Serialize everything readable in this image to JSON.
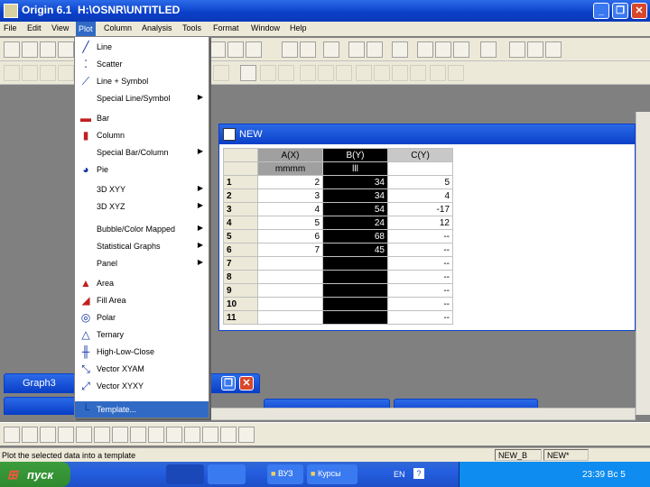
{
  "window": {
    "title": "Origin 6.1  H:\\OSNR\\UNTITLED"
  },
  "window_buttons": {
    "min": "_",
    "max": "❐",
    "close": "✕"
  },
  "menubar": {
    "items": [
      "File",
      "Edit",
      "View",
      "Plot",
      "Column",
      "Analysis",
      "Tools",
      "Format",
      "Window",
      "Help"
    ]
  },
  "plot_menu": {
    "items": [
      {
        "label": "Line",
        "icon": "line-icon",
        "glyph": "╱",
        "submenu": false
      },
      {
        "label": "Scatter",
        "icon": "scatter-icon",
        "glyph": "⁚",
        "submenu": false
      },
      {
        "label": "Line + Symbol",
        "icon": "line-symbol-icon",
        "glyph": "⟋",
        "submenu": false
      },
      {
        "label": "Special Line/Symbol",
        "icon": "",
        "glyph": "",
        "submenu": true
      },
      {
        "label": "Bar",
        "icon": "bar-icon",
        "glyph": "▬",
        "submenu": false
      },
      {
        "label": "Column",
        "icon": "column-icon",
        "glyph": "▮",
        "submenu": false
      },
      {
        "label": "Special Bar/Column",
        "icon": "",
        "glyph": "",
        "submenu": true
      },
      {
        "label": "Pie",
        "icon": "pie-icon",
        "glyph": "◕",
        "submenu": false
      },
      {
        "label": "3D XYY",
        "icon": "",
        "glyph": "",
        "submenu": true
      },
      {
        "label": "3D XYZ",
        "icon": "",
        "glyph": "",
        "submenu": true
      },
      {
        "label": "Bubble/Color Mapped",
        "icon": "",
        "glyph": "",
        "submenu": true
      },
      {
        "label": "Statistical Graphs",
        "icon": "",
        "glyph": "",
        "submenu": true
      },
      {
        "label": "Panel",
        "icon": "",
        "glyph": "",
        "submenu": true
      },
      {
        "label": "Area",
        "icon": "area-icon",
        "glyph": "▲",
        "submenu": false
      },
      {
        "label": "Fill Area",
        "icon": "fill-area-icon",
        "glyph": "◢",
        "submenu": false
      },
      {
        "label": "Polar",
        "icon": "polar-icon",
        "glyph": "◎",
        "submenu": false
      },
      {
        "label": "Ternary",
        "icon": "ternary-icon",
        "glyph": "△",
        "submenu": false
      },
      {
        "label": "High-Low-Close",
        "icon": "high-low-close-icon",
        "glyph": "╫",
        "submenu": false
      },
      {
        "label": "Vector XYAM",
        "icon": "vector-xyam-icon",
        "glyph": "⤡",
        "submenu": false
      },
      {
        "label": "Vector XYXY",
        "icon": "vector-xyxy-icon",
        "glyph": "⤢",
        "submenu": false
      },
      {
        "label": "Template...",
        "icon": "template-icon",
        "glyph": "└",
        "submenu": false
      }
    ]
  },
  "worksheet": {
    "title": "NEW",
    "columns": [
      {
        "name": "A(X)",
        "label": "mmmm"
      },
      {
        "name": "B(Y)",
        "label": "lll"
      },
      {
        "name": "C(Y)",
        "label": ""
      }
    ],
    "rows": [
      {
        "n": "1",
        "a": "2",
        "b": "34",
        "c": "5"
      },
      {
        "n": "2",
        "a": "3",
        "b": "34",
        "c": "4"
      },
      {
        "n": "3",
        "a": "4",
        "b": "54",
        "c": "-17"
      },
      {
        "n": "4",
        "a": "5",
        "b": "24",
        "c": "12"
      },
      {
        "n": "5",
        "a": "6",
        "b": "68",
        "c": "--"
      },
      {
        "n": "6",
        "a": "7",
        "b": "45",
        "c": "--"
      },
      {
        "n": "7",
        "a": "",
        "b": "",
        "c": "--"
      },
      {
        "n": "8",
        "a": "",
        "b": "",
        "c": "--"
      },
      {
        "n": "9",
        "a": "",
        "b": "",
        "c": "--"
      },
      {
        "n": "10",
        "a": "",
        "b": "",
        "c": "--"
      },
      {
        "n": "11",
        "a": "",
        "b": "",
        "c": "--"
      }
    ]
  },
  "minimized": {
    "graph3": "Graph3"
  },
  "statusbar": {
    "message": "Plot the selected data into a template",
    "pane1": "NEW_B",
    "pane2": "NEW*"
  },
  "taskbar": {
    "start": "пуск",
    "task_dir": "ВУЗ",
    "task_kursy": "Курсы",
    "lang": "EN",
    "clock": "23:39 Вс 5"
  },
  "colors": {
    "accent": "#316ac5",
    "titlebar": "#0a3fc8",
    "taskbar": "#245ee0",
    "start": "#3c9d3c"
  }
}
